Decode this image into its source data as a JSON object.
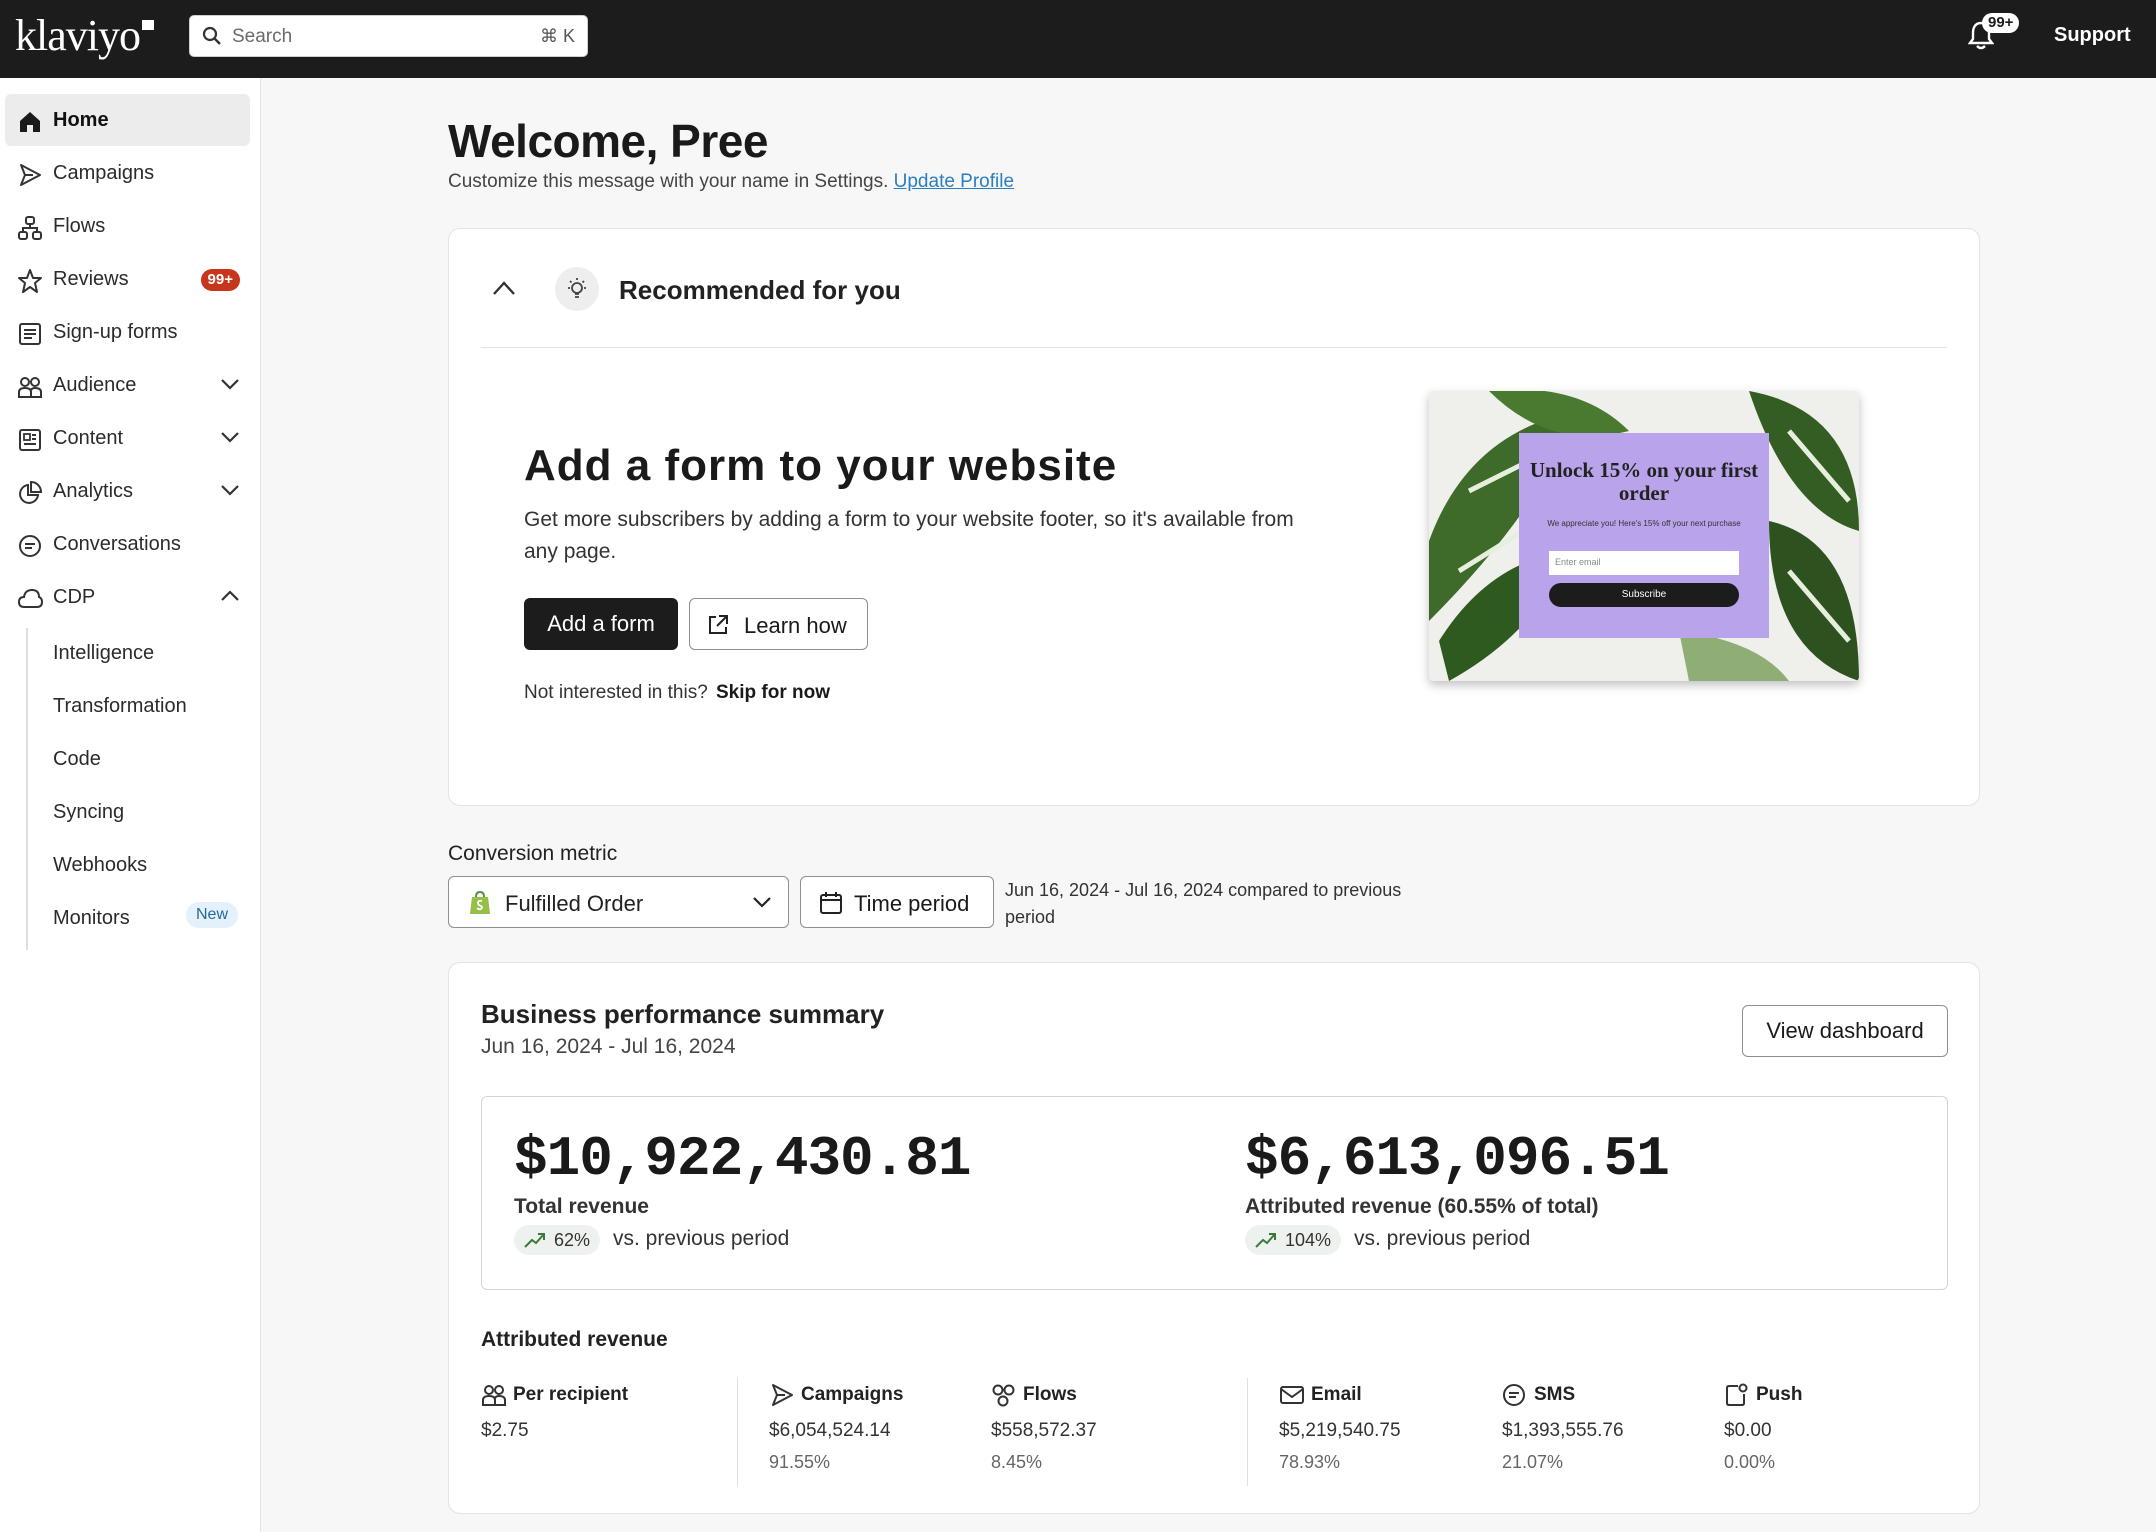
{
  "topbar": {
    "logo": "klaviyo",
    "search_placeholder": "Search",
    "search_shortcut": "⌘ K",
    "notifications_badge": "99+",
    "support_label": "Support"
  },
  "sidebar": {
    "items": [
      {
        "label": "Home",
        "icon": "home-icon"
      },
      {
        "label": "Campaigns",
        "icon": "send-icon"
      },
      {
        "label": "Flows",
        "icon": "flows-icon"
      },
      {
        "label": "Reviews",
        "icon": "star-icon",
        "badge": "99+"
      },
      {
        "label": "Sign-up forms",
        "icon": "form-icon"
      },
      {
        "label": "Audience",
        "icon": "people-icon"
      },
      {
        "label": "Content",
        "icon": "content-icon"
      },
      {
        "label": "Analytics",
        "icon": "pie-chart-icon"
      },
      {
        "label": "Conversations",
        "icon": "chat-icon"
      },
      {
        "label": "CDP",
        "icon": "cloud-icon"
      }
    ],
    "cdp_subitems": [
      {
        "label": "Intelligence"
      },
      {
        "label": "Transformation"
      },
      {
        "label": "Code"
      },
      {
        "label": "Syncing"
      },
      {
        "label": "Webhooks"
      },
      {
        "label": "Monitors",
        "badge": "New"
      }
    ]
  },
  "main": {
    "welcome": "Welcome, Pree",
    "customize_text": "Customize this message with your name in Settings.",
    "update_profile_link": "Update Profile",
    "recommended": {
      "title": "Recommended for you",
      "heading": "Add a form to your website",
      "description": "Get more subscribers by adding a form to your website footer, so it's available from any page.",
      "primary_button": "Add a form",
      "secondary_button": "Learn how",
      "not_interested": "Not interested in this?",
      "skip": "Skip for now",
      "promo": {
        "heading": "Unlock 15% on your first order",
        "subtext": "We appreciate you! Here's 15% off your next purchase",
        "input_placeholder": "Enter email",
        "button": "Subscribe"
      }
    },
    "conversion": {
      "label": "Conversion metric",
      "selected_metric": "Fulfilled Order",
      "time_period_button": "Time period",
      "range_note": "Jun 16, 2024 - Jul 16, 2024 compared to previous period"
    },
    "performance": {
      "title": "Business performance summary",
      "range": "Jun 16, 2024 - Jul 16, 2024",
      "view_dashboard": "View dashboard",
      "total_revenue": {
        "amount": "$10,922,430.81",
        "label": "Total revenue",
        "change": "62%",
        "vs": "vs. previous period"
      },
      "attributed_revenue": {
        "amount": "$6,613,096.51",
        "label": "Attributed revenue (60.55% of total)",
        "change": "104%",
        "vs": "vs. previous period"
      },
      "attributed_title": "Attributed revenue",
      "metrics": [
        {
          "label": "Per recipient",
          "icon": "people-icon",
          "value": "$2.75",
          "pct": ""
        },
        {
          "label": "Campaigns",
          "icon": "send-icon",
          "value": "$6,054,524.14",
          "pct": "91.55%"
        },
        {
          "label": "Flows",
          "icon": "flows-icon",
          "value": "$558,572.37",
          "pct": "8.45%"
        },
        {
          "label": "Email",
          "icon": "mail-icon",
          "value": "$5,219,540.75",
          "pct": "78.93%"
        },
        {
          "label": "SMS",
          "icon": "chat-icon",
          "value": "$1,393,555.76",
          "pct": "21.07%"
        },
        {
          "label": "Push",
          "icon": "push-icon",
          "value": "$0.00",
          "pct": "0.00%"
        }
      ]
    }
  }
}
